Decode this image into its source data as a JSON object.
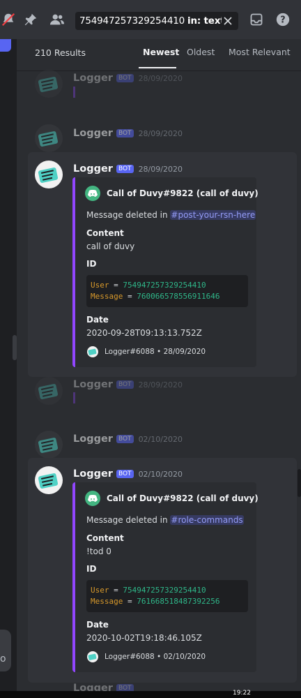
{
  "toolbar": {
    "icons": [
      "muted-notifications-icon",
      "pin-icon",
      "members-icon",
      "inbox-icon",
      "help-icon"
    ],
    "search_query": "754947257329254410",
    "search_filter": "in: text-logs",
    "left_bubble_char": "o"
  },
  "results": {
    "count": "210 Results",
    "sort_tabs": [
      "Newest",
      "Oldest",
      "Most Relevant"
    ],
    "active_sort": "Newest"
  },
  "context_messages": [
    {
      "author": "Logger",
      "bot_tag": "BOT",
      "timestamp": "28/09/2020"
    },
    {
      "author": "Logger",
      "bot_tag": "BOT",
      "timestamp": "28/09/2020"
    },
    {
      "author": "Logger",
      "bot_tag": "BOT",
      "timestamp": "28/09/2020"
    },
    {
      "author": "Logger",
      "bot_tag": "BOT",
      "timestamp": "02/10/2020"
    },
    {
      "author": "Logger",
      "bot_tag": "BOT",
      "timestamp": ""
    }
  ],
  "cards": [
    {
      "author": "Logger",
      "bot_tag": "BOT",
      "timestamp": "28/09/2020",
      "embed": {
        "author": "Call of Duvy#9822 (call of duvy)",
        "description_prefix": "Message deleted in",
        "channel": "#post-your-rsn-here",
        "content_label": "Content",
        "content_value": "call of duvy",
        "id_label": "ID",
        "user_key": "User",
        "user_id": "754947257329254410",
        "message_key": "Message",
        "message_id": "760066578556911646",
        "date_label": "Date",
        "date_value": "2020-09-28T09:13:13.752Z",
        "footer": "Logger#6088 • 28/09/2020"
      }
    },
    {
      "author": "Logger",
      "bot_tag": "BOT",
      "timestamp": "02/10/2020",
      "embed": {
        "author": "Call of Duvy#9822 (call of duvy)",
        "description_prefix": "Message deleted in",
        "channel": "#role-commands",
        "content_label": "Content",
        "content_value": "!tod 0",
        "id_label": "ID",
        "user_key": "User",
        "user_id": "754947257329254410",
        "message_key": "Message",
        "message_id": "761668518487392256",
        "date_label": "Date",
        "date_value": "2020-10-02T19:18:46.105Z",
        "footer": "Logger#6088 • 02/10/2020"
      }
    }
  ],
  "taskbar": {
    "time": "19:22"
  },
  "colors": {
    "background": "#2b2d31",
    "card": "#313338",
    "embed_accent": "#9146ff",
    "bot_tag": "#5865f2",
    "code_key": "#d99a2b",
    "code_value": "#2fb88a"
  }
}
